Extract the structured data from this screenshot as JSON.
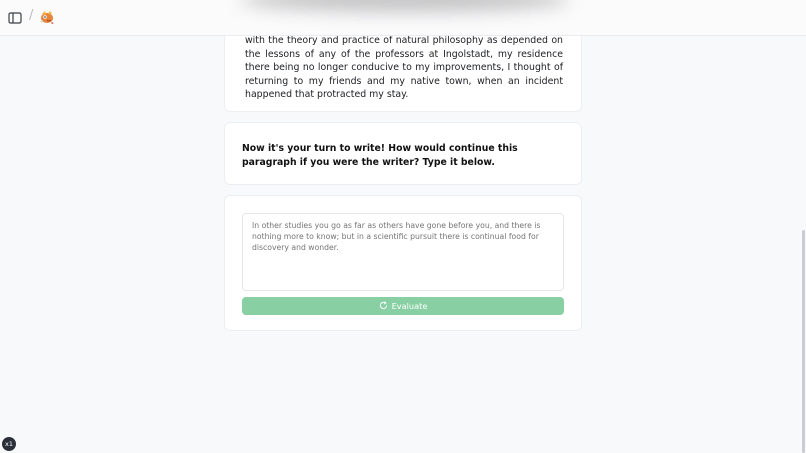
{
  "header": {
    "sidebar_toggle_icon": "sidebar-toggle-icon",
    "separator": "/",
    "logo_icon": "app-logo-icon"
  },
  "passage": {
    "text": "with the theory and practice of natural philosophy as depended on the lessons of any of the professors at Ingolstadt, my residence there being no longer conducive to my improvements, I thought of returning to my friends and my native town, when an incident happened that protracted my stay."
  },
  "prompt": {
    "text": "Now it's your turn to write! How would continue this paragraph if you were the writer? Type it below."
  },
  "input": {
    "placeholder": "In other studies you go as far as others have gone before you, and there is nothing more to know; but in a scientific pursuit there is continual food for discovery and wonder.",
    "value": ""
  },
  "evaluate": {
    "label": "Evaluate",
    "icon": "refresh-icon",
    "color": "#88d0a4"
  },
  "badge": {
    "label": "x1"
  }
}
